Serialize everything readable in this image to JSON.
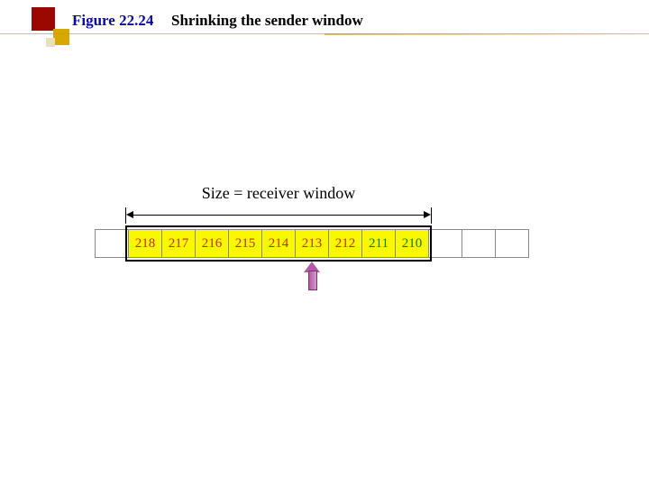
{
  "header": {
    "figure_label": "Figure 22.24",
    "caption": "Shrinking the sender window"
  },
  "diagram": {
    "size_label": "Size = receiver window",
    "cells": [
      {
        "v": "",
        "in_window": false,
        "sent": false
      },
      {
        "v": "218",
        "in_window": true,
        "sent": false
      },
      {
        "v": "217",
        "in_window": true,
        "sent": false
      },
      {
        "v": "216",
        "in_window": true,
        "sent": false
      },
      {
        "v": "215",
        "in_window": true,
        "sent": false
      },
      {
        "v": "214",
        "in_window": true,
        "sent": false
      },
      {
        "v": "213",
        "in_window": true,
        "sent": false
      },
      {
        "v": "212",
        "in_window": true,
        "sent": false
      },
      {
        "v": "211",
        "in_window": true,
        "sent": true
      },
      {
        "v": "210",
        "in_window": true,
        "sent": true
      },
      {
        "v": "",
        "in_window": false,
        "sent": false
      },
      {
        "v": "",
        "in_window": false,
        "sent": false
      },
      {
        "v": "",
        "in_window": false,
        "sent": false
      }
    ],
    "pointer_cell_index": 6
  }
}
